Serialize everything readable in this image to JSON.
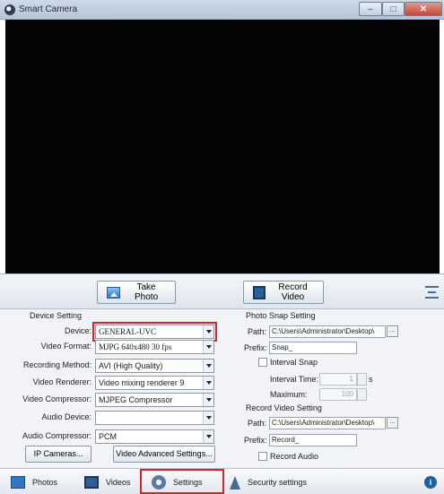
{
  "window": {
    "title": "Smart Camera",
    "controls": {
      "minimize": "–",
      "maximize": "□",
      "close": "✕"
    }
  },
  "actions": {
    "take_photo": "Take Photo",
    "record_video": "Record Video"
  },
  "device_setting": {
    "title": "Device Setting",
    "device_label": "Device:",
    "device_value": "GENERAL-UVC",
    "video_format_label": "Video Format:",
    "video_format_value": "MJPG 640x480 30 fps",
    "recording_method_label": "Recording Method:",
    "recording_method_value": "AVI (High Quality)",
    "video_renderer_label": "Video Renderer:",
    "video_renderer_value": "Video mixing renderer 9",
    "video_compressor_label": "Video Compressor:",
    "video_compressor_value": "MJPEG Compressor",
    "audio_device_label": "Audio Device:",
    "audio_device_value": "",
    "audio_compressor_label": "Audio Compressor:",
    "audio_compressor_value": "PCM",
    "ip_cameras_button": "IP Cameras...",
    "video_advanced_button": "Video Advanced Settings..."
  },
  "photo_snap": {
    "title": "Photo Snap Setting",
    "path_label": "Path:",
    "path_value": "C:\\Users\\Administrator\\Desktop\\",
    "browse": "...",
    "prefix_label": "Prefix:",
    "prefix_value": "Snap_",
    "interval_snap_label": "Interval Snap",
    "interval_time_label": "Interval Time:",
    "interval_time_value": "1",
    "interval_time_unit": "s",
    "maximum_label": "Maximum:",
    "maximum_value": "100"
  },
  "record_video": {
    "title": "Record Video Setting",
    "path_label": "Path:",
    "path_value": "C:\\Users\\Administrator\\Desktop\\",
    "browse": "...",
    "prefix_label": "Prefix:",
    "prefix_value": "Record_",
    "record_audio_label": "Record Audio"
  },
  "tabs": [
    {
      "label": "Photos",
      "icon": "photos-icon"
    },
    {
      "label": "Videos",
      "icon": "videos-icon"
    },
    {
      "label": "Settings",
      "icon": "settings-icon",
      "selected": true
    },
    {
      "label": "Security settings",
      "icon": "security-icon"
    }
  ],
  "info_glyph": "i",
  "colors": {
    "highlight": "#d9232a",
    "preview_background": "#050505"
  }
}
